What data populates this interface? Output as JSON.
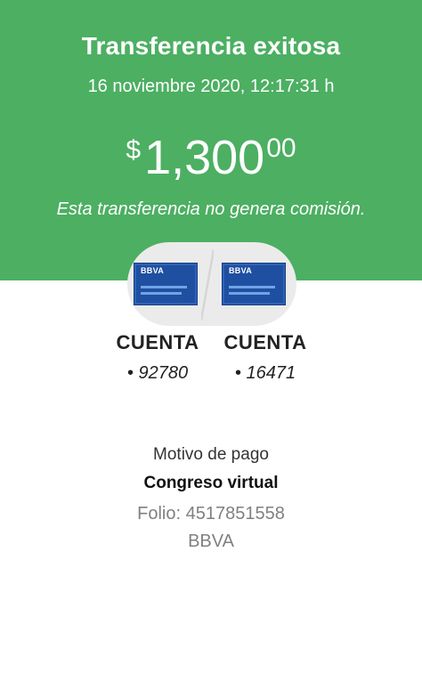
{
  "header": {
    "title": "Transferencia exitosa",
    "datetime": "16 noviembre 2020, 12:17:31 h",
    "amount": {
      "currency": "$",
      "integer": "1,300",
      "cents": "00"
    },
    "note": "Esta transferencia no genera comisión."
  },
  "accounts": {
    "from": {
      "card_brand": "BBVA",
      "label": "CUENTA",
      "number": "• 92780"
    },
    "to": {
      "card_brand": "BBVA",
      "label": "CUENTA",
      "number": "• 16471"
    }
  },
  "details": {
    "reason_label": "Motivo de pago",
    "reason_value": "Congreso virtual",
    "folio": "Folio: 4517851558",
    "bank": "BBVA"
  },
  "colors": {
    "header_bg": "#4caf62",
    "card_blue": "#1f4fa0",
    "text_gray": "#808080"
  }
}
